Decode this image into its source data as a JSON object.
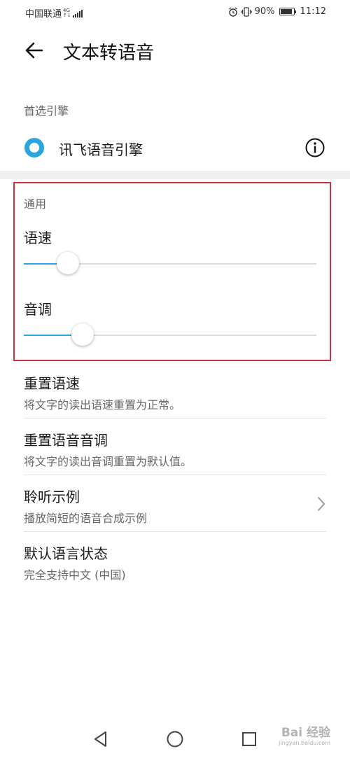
{
  "status_bar": {
    "carrier": "中国联通",
    "network_top": "4G",
    "network_bottom": "↑↓",
    "battery_percent": "90%",
    "battery_level": 0.9,
    "time": "11:12"
  },
  "header": {
    "title": "文本转语音"
  },
  "preferred_engine": {
    "section_label": "首选引擎",
    "engine_name": "讯飞语音引擎",
    "selected": true
  },
  "general": {
    "section_label": "通用",
    "speech_rate": {
      "label": "语速",
      "value": 0.15
    },
    "pitch": {
      "label": "音调",
      "value": 0.2
    }
  },
  "list_items": [
    {
      "title": "重置语速",
      "subtitle": "将文字的读出语速重置为正常。"
    },
    {
      "title": "重置语音音调",
      "subtitle": "将文字的读出音调重置为默认值。"
    },
    {
      "title": "聆听示例",
      "subtitle": "播放简短的语音合成示例"
    },
    {
      "title": "默认语言状态",
      "subtitle": "完全支持中文 (中国)"
    }
  ],
  "watermark": {
    "brand": "Bai 经验",
    "url": "jingyan.baidu.com"
  },
  "colors": {
    "accent": "#2aa6dd",
    "highlight_border": "#c8343e"
  },
  "icons": {
    "back": "arrow-left-icon",
    "info": "info-circle-icon",
    "chevron": "chevron-right-icon",
    "nav_back": "triangle-back-icon",
    "nav_home": "circle-home-icon",
    "nav_recent": "square-recents-icon"
  }
}
